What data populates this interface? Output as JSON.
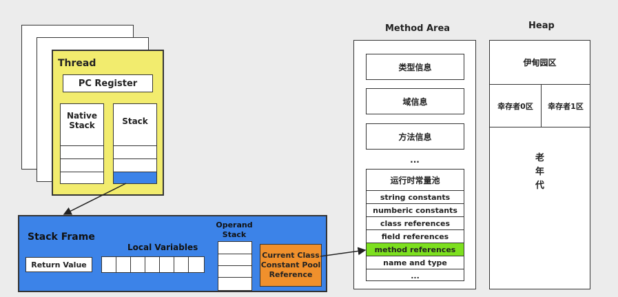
{
  "thread": {
    "title": "Thread",
    "pc_register": "PC Register",
    "native_stack": "Native\nStack",
    "stack": "Stack"
  },
  "stack_frame": {
    "title": "Stack Frame",
    "local_variables": "Local Variables",
    "operand_stack": "Operand\nStack",
    "return_value": "Return Value",
    "constant_pool_ref": "Current Class\nConstant Pool\nReference"
  },
  "method_area": {
    "title": "Method Area",
    "type_info": "类型信息",
    "field_info": "域信息",
    "method_info": "方法信息",
    "ellipsis": "...",
    "runtime_pool": {
      "title": "运行时常量池",
      "rows": [
        "string constants",
        "numberic constants",
        "class references",
        "field references",
        "method references",
        "name and type",
        "..."
      ],
      "highlight_index": 4
    }
  },
  "heap": {
    "title": "Heap",
    "eden": "伊甸园区",
    "survivor0": "幸存者0区",
    "survivor1": "幸存者1区",
    "old_gen": "老\n年\n代"
  },
  "colors": {
    "thread_bg": "#f2ec6e",
    "frame_bg": "#3c83e8",
    "pool_ref_bg": "#f0902c",
    "highlight": "#7de01f",
    "stack_top": "#3c83e8"
  }
}
